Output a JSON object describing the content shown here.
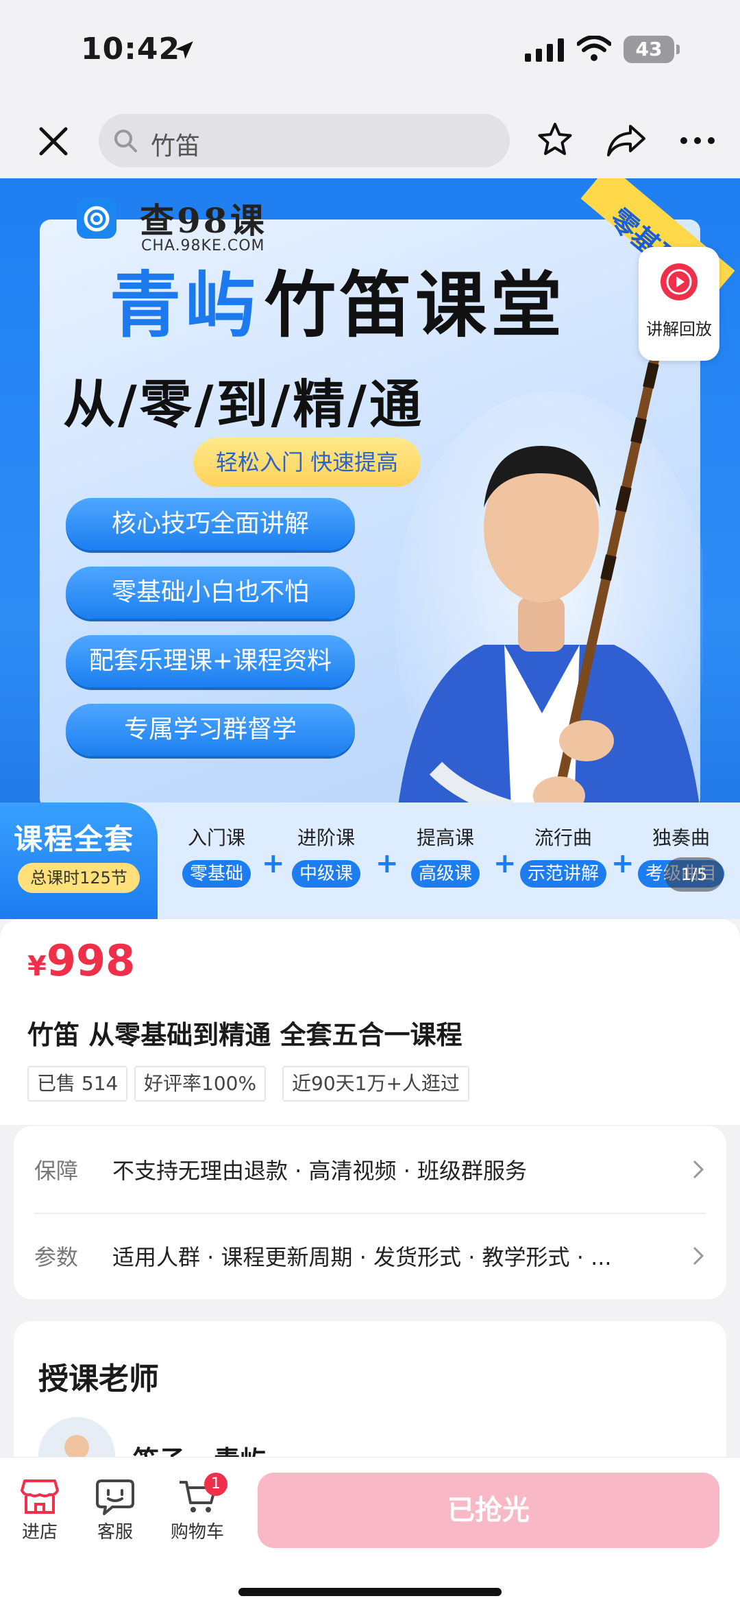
{
  "status_bar": {
    "time": "10:42",
    "battery": "43"
  },
  "nav": {
    "search_text": "竹笛"
  },
  "hero": {
    "logo_name": "查98课",
    "logo_url_text": "CHA.98KE.COM",
    "title_part1": "青屿",
    "title_part2": "竹笛课堂",
    "corner_tag": "零基础",
    "subtitle": "从/零/到/精/通",
    "slogan": "轻松入门 快速提高",
    "features": [
      "核心技巧全面讲解",
      "零基础小白也不怕",
      "配套乐理课+课程资料",
      "专属学习群督学"
    ],
    "replay_label": "讲解回放",
    "strip_title": "课程全套",
    "strip_hours": "总课时125节",
    "modules": [
      {
        "name": "入门课",
        "tag": "零基础"
      },
      {
        "name": "进阶课",
        "tag": "中级课"
      },
      {
        "name": "提高课",
        "tag": "高级课"
      },
      {
        "name": "流行曲",
        "tag": "示范讲解"
      },
      {
        "name": "独奏曲",
        "tag": "考级曲目"
      }
    ],
    "plus_symbol": "+",
    "counter": "1/5"
  },
  "product": {
    "currency": "¥",
    "price": "998",
    "title": "竹笛 从零基础到精通 全套五合一课程",
    "chips": [
      "已售 514",
      "好评率100%",
      "近90天1万+人逛过"
    ]
  },
  "guarantee": {
    "label": "保障",
    "text": "不支持无理由退款 · 高清视频 · 班级群服务"
  },
  "params": {
    "label": "参数",
    "text": "适用人群 · 课程更新周期 · 发货形式 · 教学形式 · ..."
  },
  "teacher_section": {
    "title": "授课老师",
    "name": "笛子 - 青屿"
  },
  "bottom_bar": {
    "store_label": "进店",
    "service_label": "客服",
    "cart_label": "购物车",
    "cart_count": "1",
    "buy_label": "已抢光"
  },
  "colors": {
    "price_red": "#f0304a",
    "brand_blue": "#1c7cf0",
    "buy_disabled": "#f9b8c6"
  }
}
